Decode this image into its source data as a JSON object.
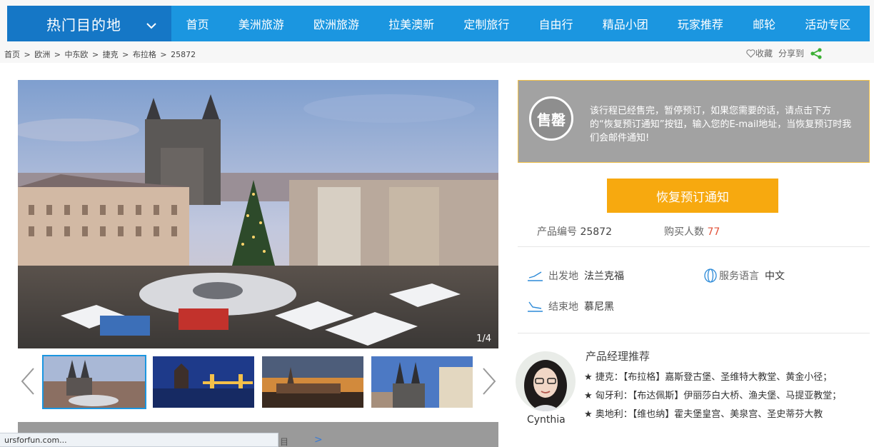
{
  "nav": {
    "hot_label": "热门目的地",
    "items": [
      "首页",
      "美洲旅游",
      "欧洲旅游",
      "拉美澳新",
      "定制旅行",
      "自由行",
      "精品小团",
      "玩家推荐",
      "邮轮",
      "活动专区"
    ]
  },
  "breadcrumb": {
    "items": [
      "首页",
      "欧洲",
      "中东欧",
      "捷克",
      "布拉格",
      "25872"
    ],
    "separator": ">",
    "favorite": "收藏",
    "share": "分享到"
  },
  "gallery": {
    "counter": "1/4",
    "thumb_count": 4,
    "active_index": 0
  },
  "sold": {
    "badge": "售罄",
    "message": "该行程已经售完，暂停预订，如果您需要的话，请点击下方的“恢复预订通知”按钮，输入您的E-mail地址，当恢复预订时我们会邮件通知!"
  },
  "restore_button": "恢复预订通知",
  "product": {
    "code_label": "产品编号",
    "code": "25872",
    "buyers_label": "购买人数",
    "buyers": "77"
  },
  "trip": {
    "depart_label": "出发地",
    "depart": "法兰克福",
    "lang_label": "服务语言",
    "lang": "中文",
    "end_label": "结束地",
    "end": "慕尼黑"
  },
  "manager": {
    "title": "产品经理推荐",
    "name": "Cynthia",
    "recs": [
      "★ 捷克：【布拉格】嘉斯登古堡、圣维特大教堂、黄金小径；",
      "★ 匈牙利：【布达佩斯】伊丽莎白大桥、渔夫堡、马提亚教堂；",
      "★ 奥地利：【维也纳】霍夫堡皇宫、美泉宫、圣史蒂芬大教"
    ]
  },
  "status": {
    "url": "ursforfun.com...",
    "under_text": "目",
    "under_arrow": ">"
  },
  "colors": {
    "nav_blue": "#1b96e0",
    "nav_dark": "#1577c6",
    "button_orange": "#f7a90f",
    "accent_red": "#e2523a",
    "share_green": "#3cb034"
  }
}
